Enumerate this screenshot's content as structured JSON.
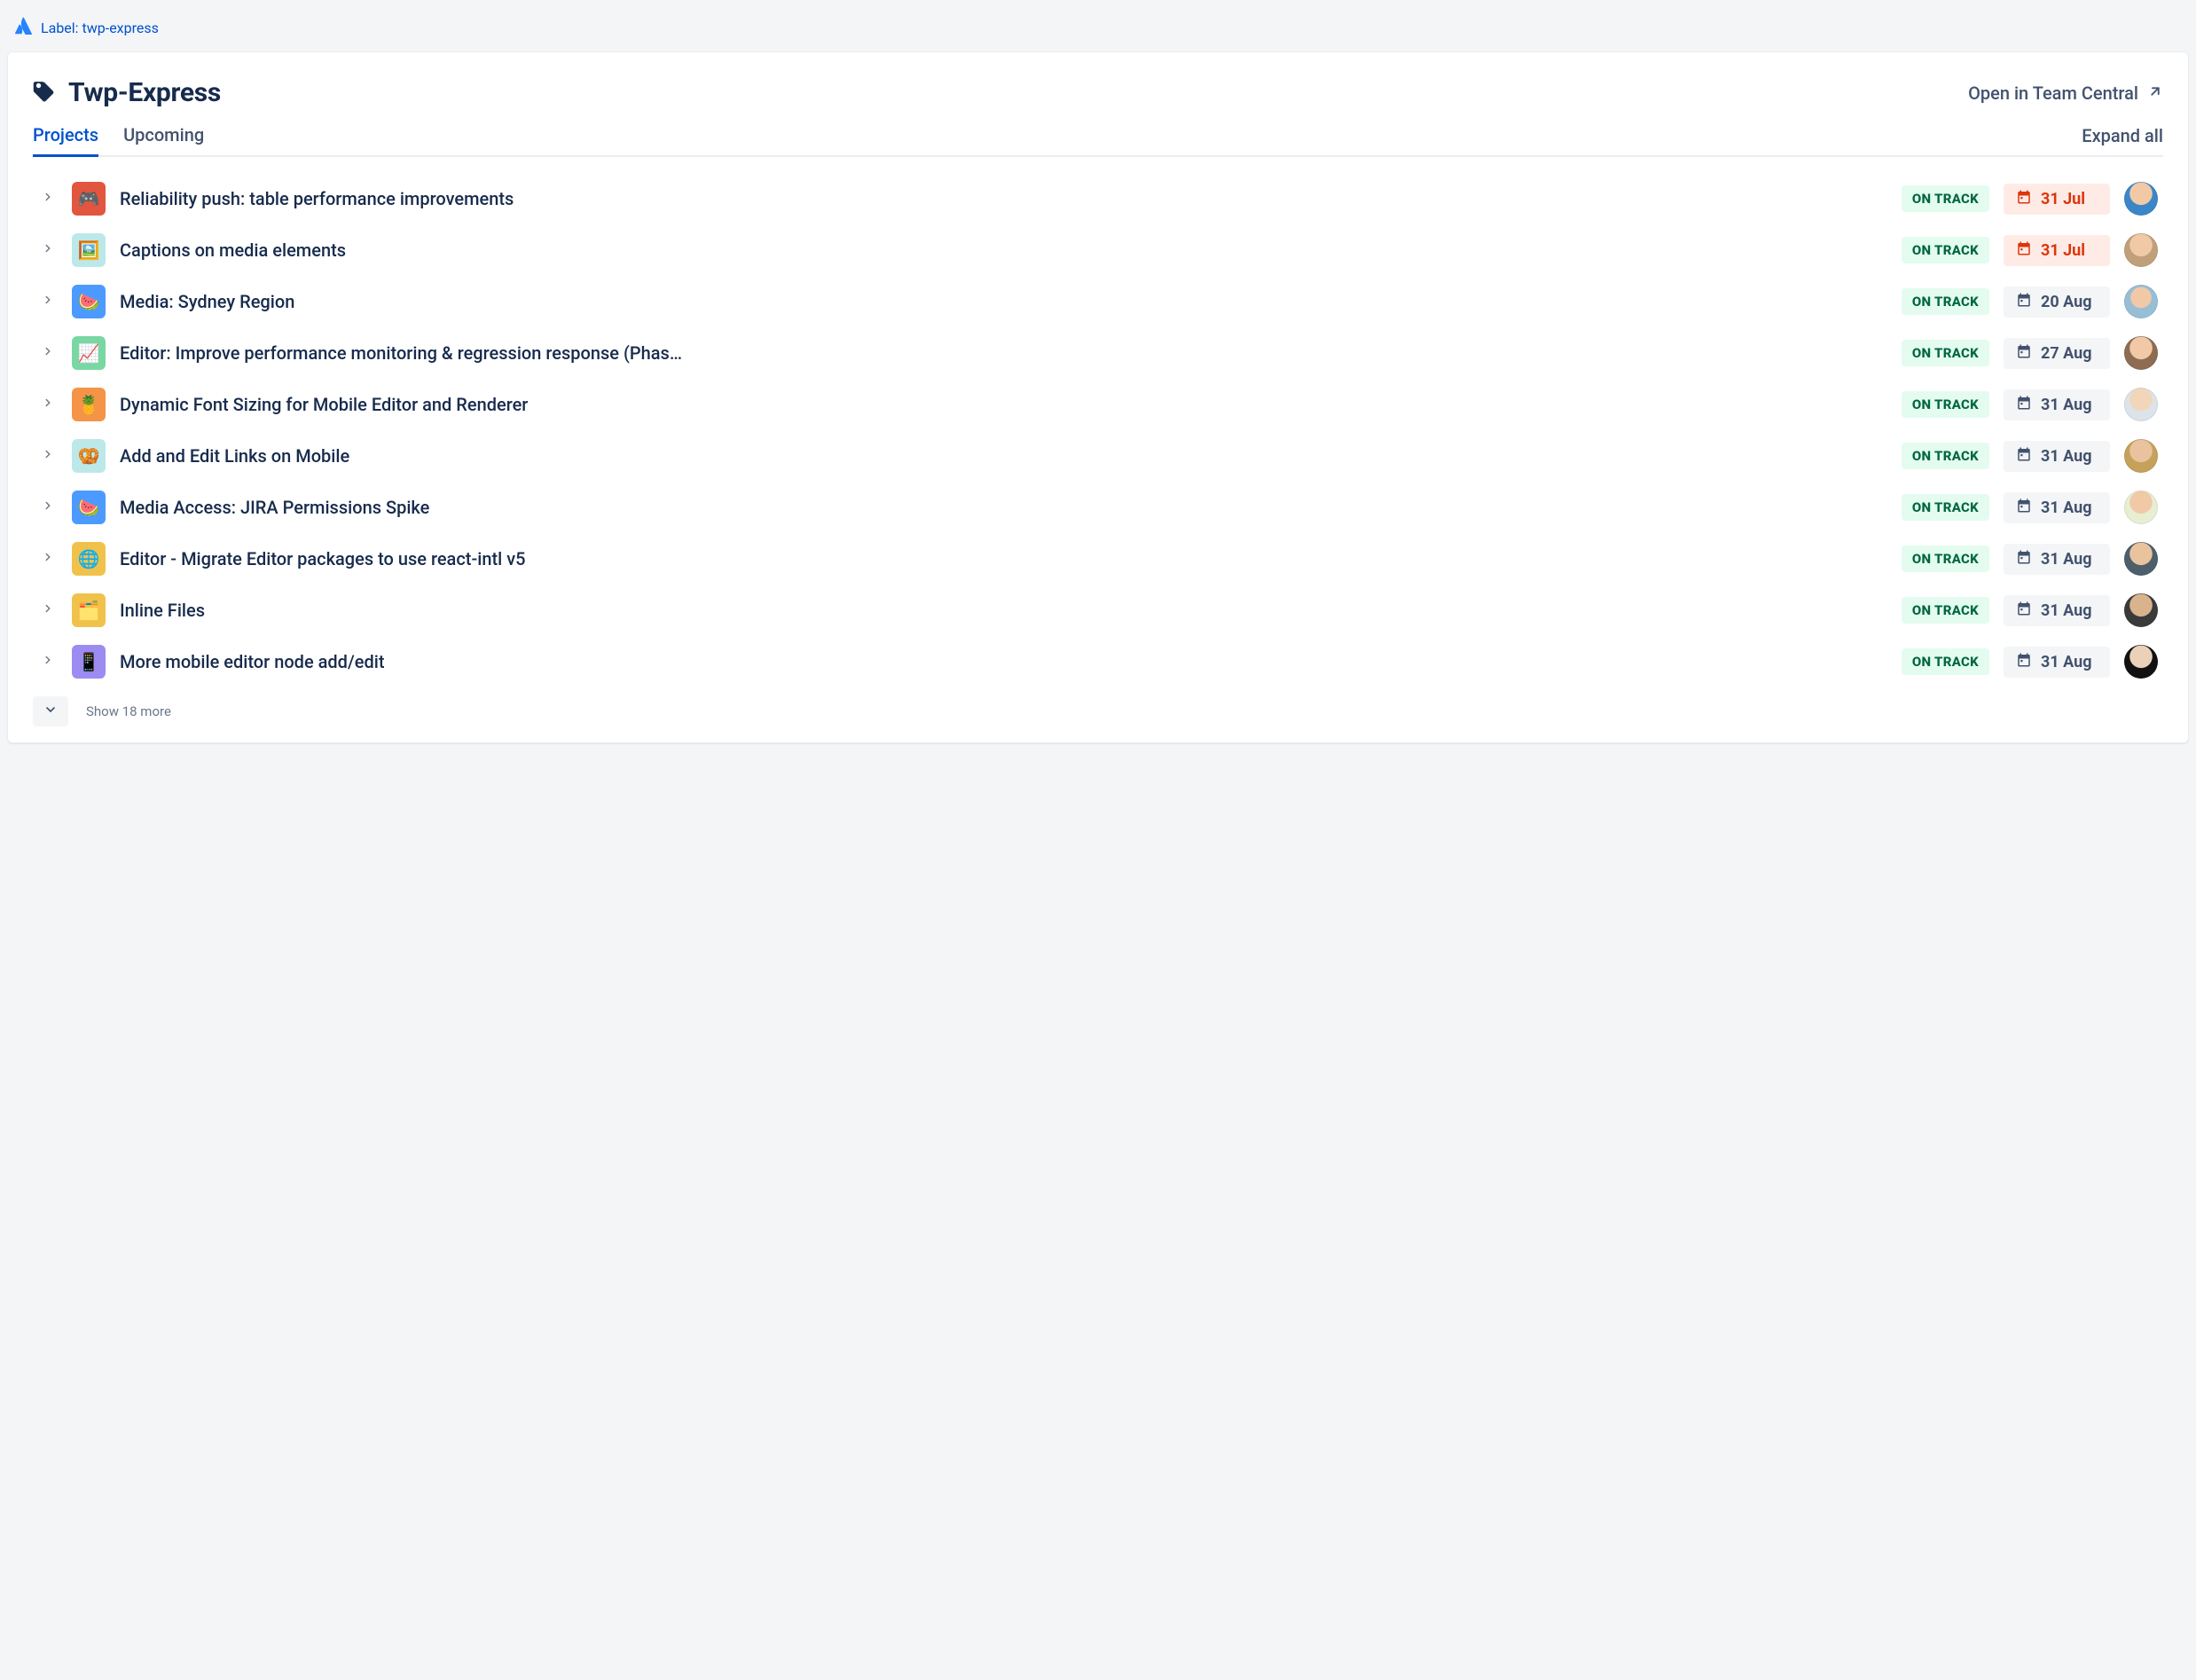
{
  "breadcrumb": {
    "label": "Label: twp-express"
  },
  "header": {
    "title": "Twp-Express",
    "open_link": "Open in Team Central"
  },
  "tabs": {
    "projects": "Projects",
    "upcoming": "Upcoming",
    "active": 0
  },
  "actions": {
    "expand_all": "Expand all"
  },
  "footer": {
    "show_more": "Show 18 more"
  },
  "status_labels": {
    "on_track": "ON TRACK"
  },
  "projects": [
    {
      "title": "Reliability push: table performance improvements",
      "status": "on_track",
      "date": "31 Jul",
      "date_warn": true,
      "icon_bg": "#E2553F",
      "icon": "🎮",
      "avatar": "av-a"
    },
    {
      "title": "Captions on media elements",
      "status": "on_track",
      "date": "31 Jul",
      "date_warn": true,
      "icon_bg": "#BCE8EA",
      "icon": "🖼️",
      "avatar": "av-b"
    },
    {
      "title": "Media: Sydney Region",
      "status": "on_track",
      "date": "20 Aug",
      "date_warn": false,
      "icon_bg": "#4C9AFF",
      "icon": "🍉",
      "avatar": "av-c"
    },
    {
      "title": "Editor: Improve performance monitoring & regression response (Phas…",
      "status": "on_track",
      "date": "27 Aug",
      "date_warn": false,
      "icon_bg": "#79D7A3",
      "icon": "📈",
      "avatar": "av-d"
    },
    {
      "title": "Dynamic Font Sizing for Mobile Editor and Renderer",
      "status": "on_track",
      "date": "31 Aug",
      "date_warn": false,
      "icon_bg": "#F59447",
      "icon": "🍍",
      "avatar": "av-e"
    },
    {
      "title": "Add and Edit Links on Mobile",
      "status": "on_track",
      "date": "31 Aug",
      "date_warn": false,
      "icon_bg": "#BCE8EA",
      "icon": "🥨",
      "avatar": "av-f"
    },
    {
      "title": "Media Access: JIRA Permissions Spike",
      "status": "on_track",
      "date": "31 Aug",
      "date_warn": false,
      "icon_bg": "#4C9AFF",
      "icon": "🍉",
      "avatar": "av-g"
    },
    {
      "title": "Editor - Migrate Editor packages to use react-intl v5",
      "status": "on_track",
      "date": "31 Aug",
      "date_warn": false,
      "icon_bg": "#F0C24B",
      "icon": "🌐",
      "avatar": "av-h"
    },
    {
      "title": "Inline Files",
      "status": "on_track",
      "date": "31 Aug",
      "date_warn": false,
      "icon_bg": "#F0C24B",
      "icon": "🗂️",
      "avatar": "av-i"
    },
    {
      "title": "More mobile editor node add/edit",
      "status": "on_track",
      "date": "31 Aug",
      "date_warn": false,
      "icon_bg": "#9C8CF2",
      "icon": "📱",
      "avatar": "av-j"
    }
  ]
}
